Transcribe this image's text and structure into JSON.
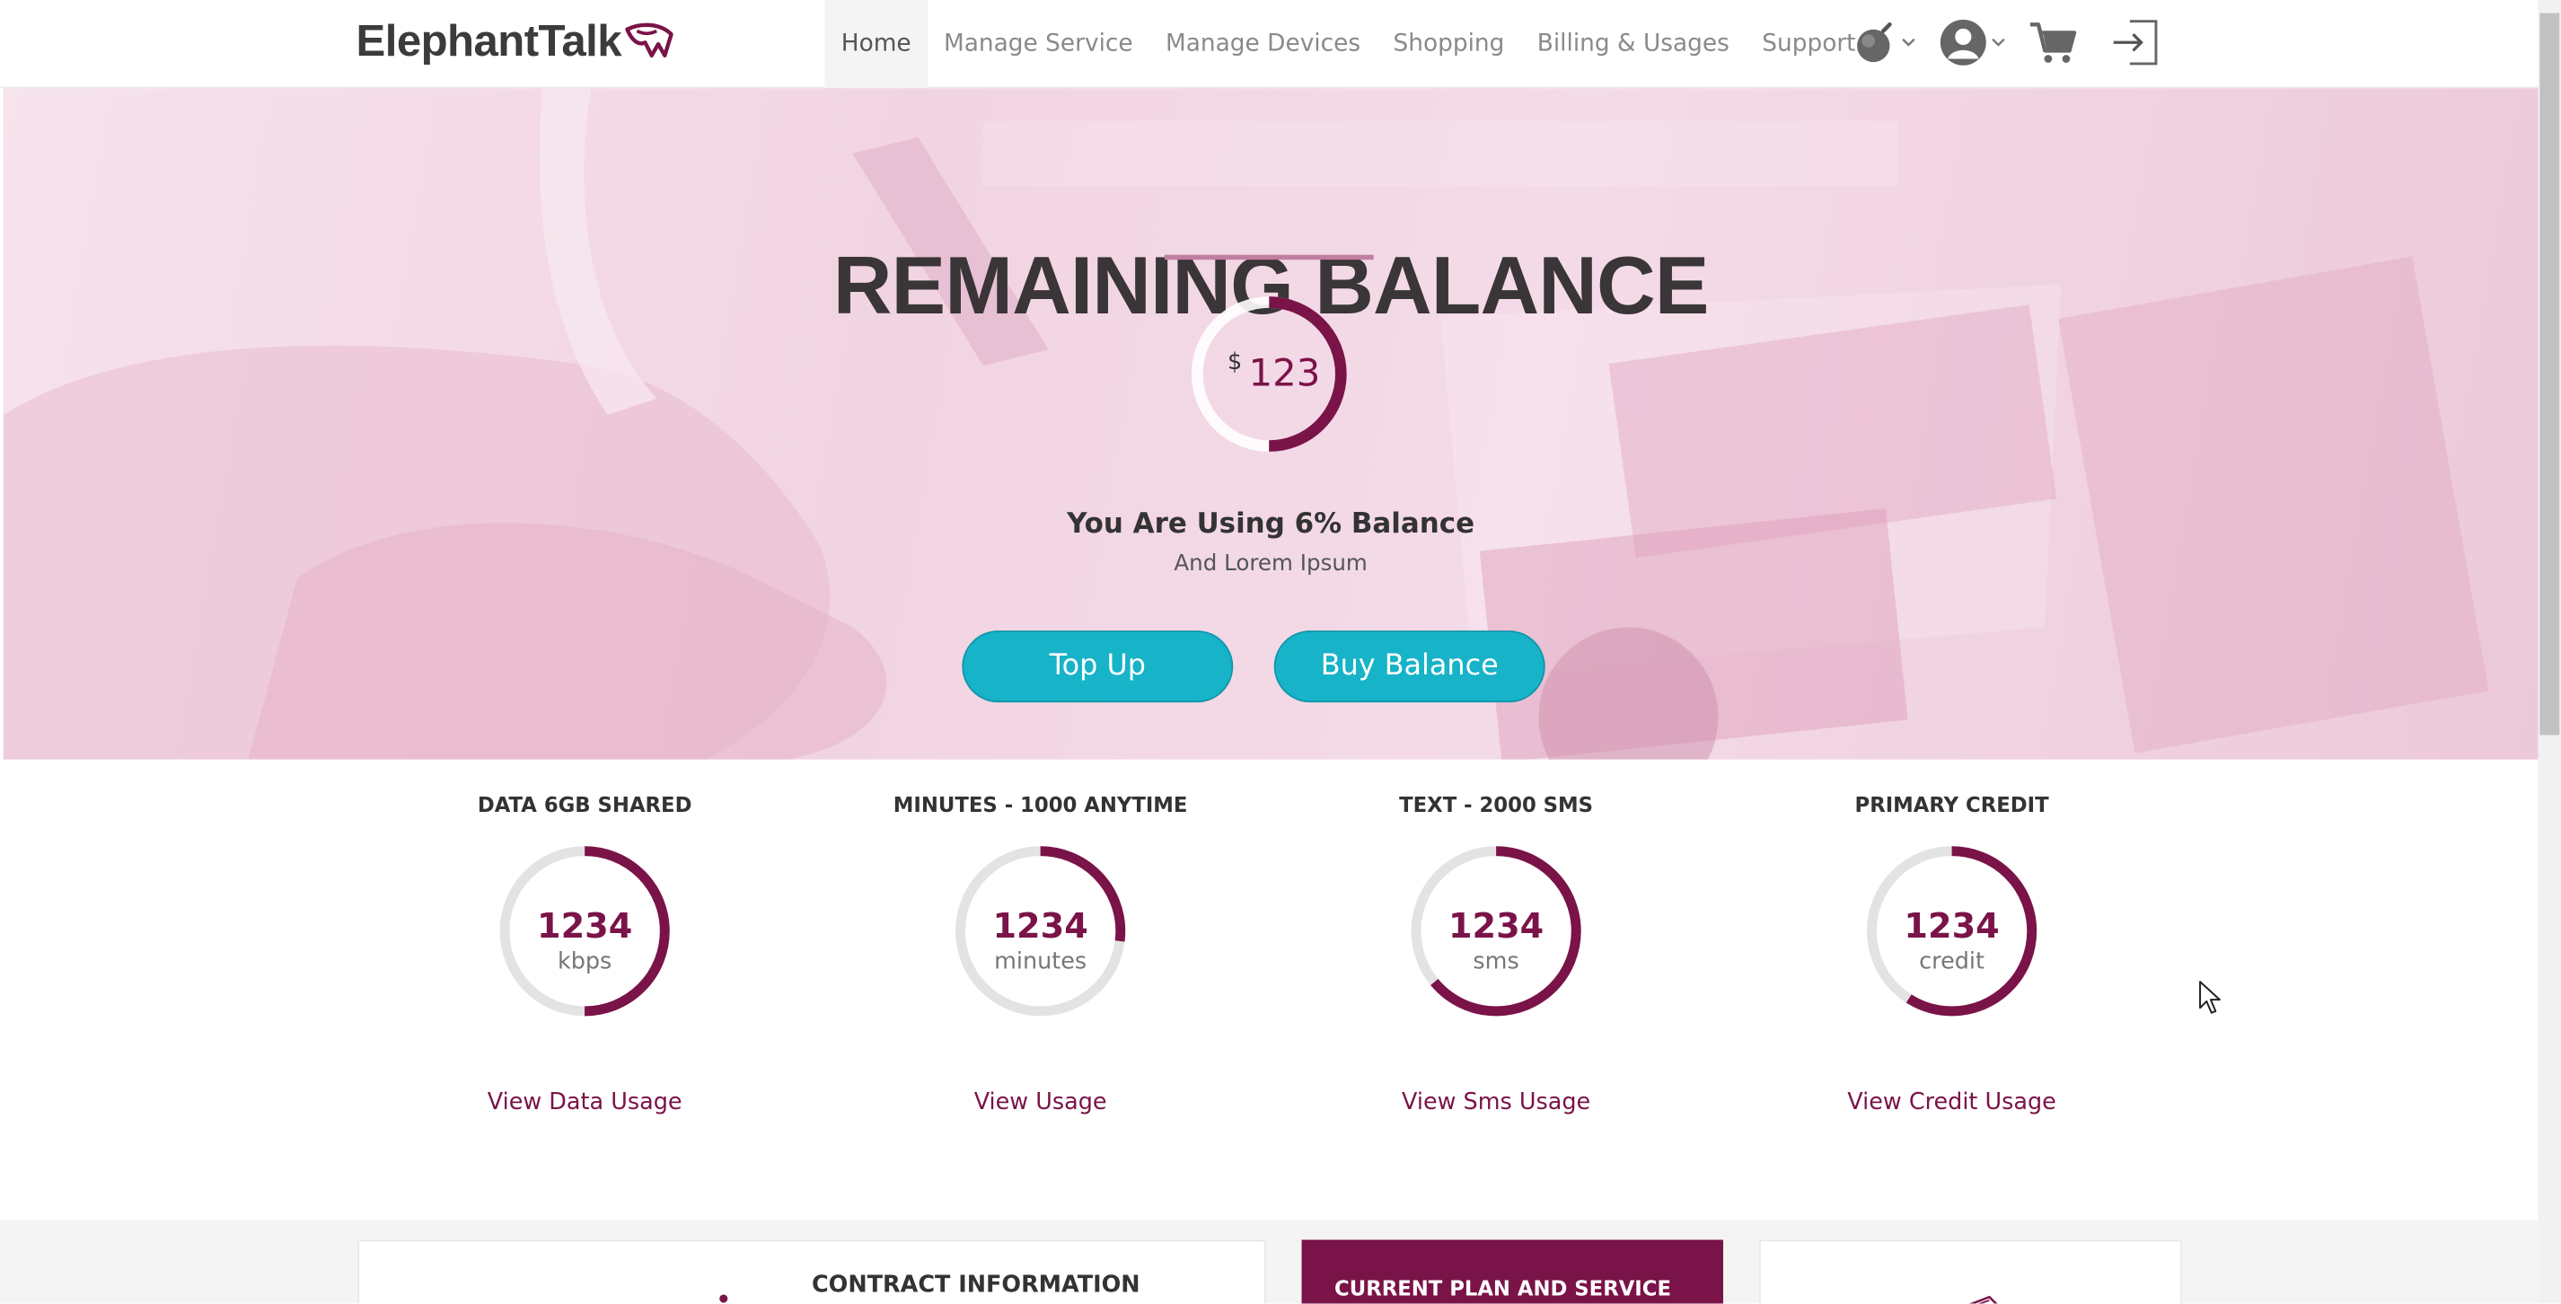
{
  "header": {
    "logo_text": "ElephantTalk",
    "nav": [
      "Home",
      "Manage Service",
      "Manage Devices",
      "Shopping",
      "Billing & Usages",
      "Support"
    ],
    "icons": [
      "bomb-icon",
      "user-avatar-icon",
      "shopping-cart-icon",
      "sign-out-icon"
    ]
  },
  "hero": {
    "title": "REMAINING BALANCE",
    "currency": "$",
    "amount": "123",
    "ring_fraction": 0.5,
    "using_text": "You Are Using 6% Balance",
    "subtext": "And Lorem Ipsum",
    "buttons": {
      "topup": "Top Up",
      "buy": "Buy Balance"
    }
  },
  "usage": [
    {
      "title": "DATA 6GB SHARED",
      "value": "1234",
      "unit": "kbps",
      "link": "View Data Usage",
      "fraction": 0.5
    },
    {
      "title": "MINUTES - 1000 ANYTIME",
      "value": "1234",
      "unit": "minutes",
      "link": "View Usage",
      "fraction": 0.27
    },
    {
      "title": "TEXT - 2000 SMS",
      "value": "1234",
      "unit": "sms",
      "link": "View Sms Usage",
      "fraction": 0.64
    },
    {
      "title": "PRIMARY CREDIT",
      "value": "1234",
      "unit": "credit",
      "link": "View Credit Usage",
      "fraction": 0.59
    }
  ],
  "bottom": {
    "contract_title": "CONTRACT INFORMATION",
    "plan_title": "CURRENT PLAN AND SERVICE"
  },
  "colors": {
    "brand": "#7a1348",
    "accent": "#17b3c9",
    "track": "#e3e3e3"
  }
}
